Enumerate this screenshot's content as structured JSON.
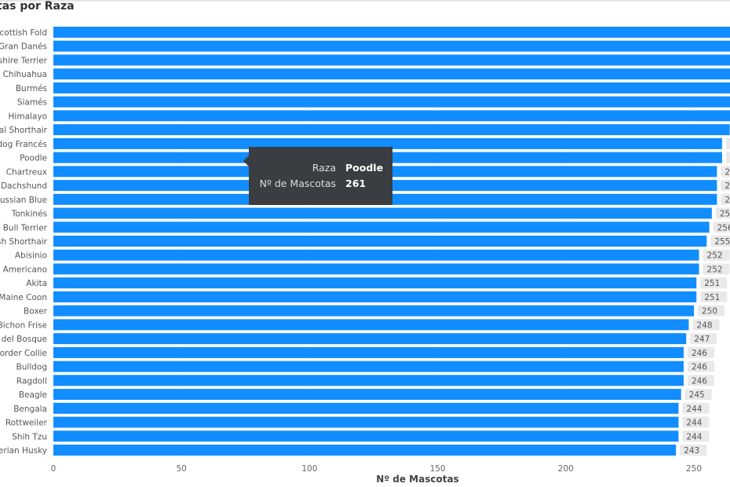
{
  "title": "tas por Raza",
  "tooltip": {
    "rows": [
      {
        "label": "Raza",
        "value": "Poodle"
      },
      {
        "label": "Nº de Mascotas",
        "value": "261"
      }
    ]
  },
  "chart_data": {
    "type": "bar",
    "orientation": "horizontal",
    "xlabel": "Nº de Mascotas",
    "ylabel": "",
    "xlim": [
      0,
      263
    ],
    "xticks": [
      0,
      50,
      100,
      150,
      200,
      250
    ],
    "grid": true,
    "bar_color": "#118DFF",
    "categories": [
      "Scottish Fold",
      "Gran Danés",
      "rkshire Terrier",
      "Chihuahua",
      "Burmés",
      "Siamés",
      "Himalayo",
      "ntal Shorthair",
      "lldog Francés",
      "Poodle",
      "Chartreux",
      "Dachshund",
      "Russian Blue",
      "Tonkinés",
      "re Bull Terrier",
      "tish Shorthair",
      "Abisinio",
      "se Americano",
      "Akita",
      "Maine Coon",
      "Boxer",
      "Bichon Frise",
      "o del Bosque",
      "Border Collie",
      "Bulldog",
      "Ragdoll",
      "Beagle",
      "Bengala",
      "Rottweiler",
      "Shih Tzu",
      "berian Husky"
    ],
    "values": [
      270,
      269,
      268,
      267,
      266,
      265,
      265,
      264,
      261,
      261,
      259,
      259,
      259,
      257,
      256,
      255,
      252,
      252,
      251,
      251,
      250,
      248,
      247,
      246,
      246,
      246,
      245,
      244,
      244,
      244,
      243
    ],
    "data_labels": [
      "",
      "",
      "",
      "",
      "",
      "",
      "",
      "",
      "",
      "",
      "2",
      "2",
      "2",
      "25",
      "256",
      "255",
      "252",
      "252",
      "251",
      "251",
      "250",
      "248",
      "247",
      "246",
      "246",
      "246",
      "245",
      "244",
      "244",
      "244",
      "243"
    ]
  }
}
